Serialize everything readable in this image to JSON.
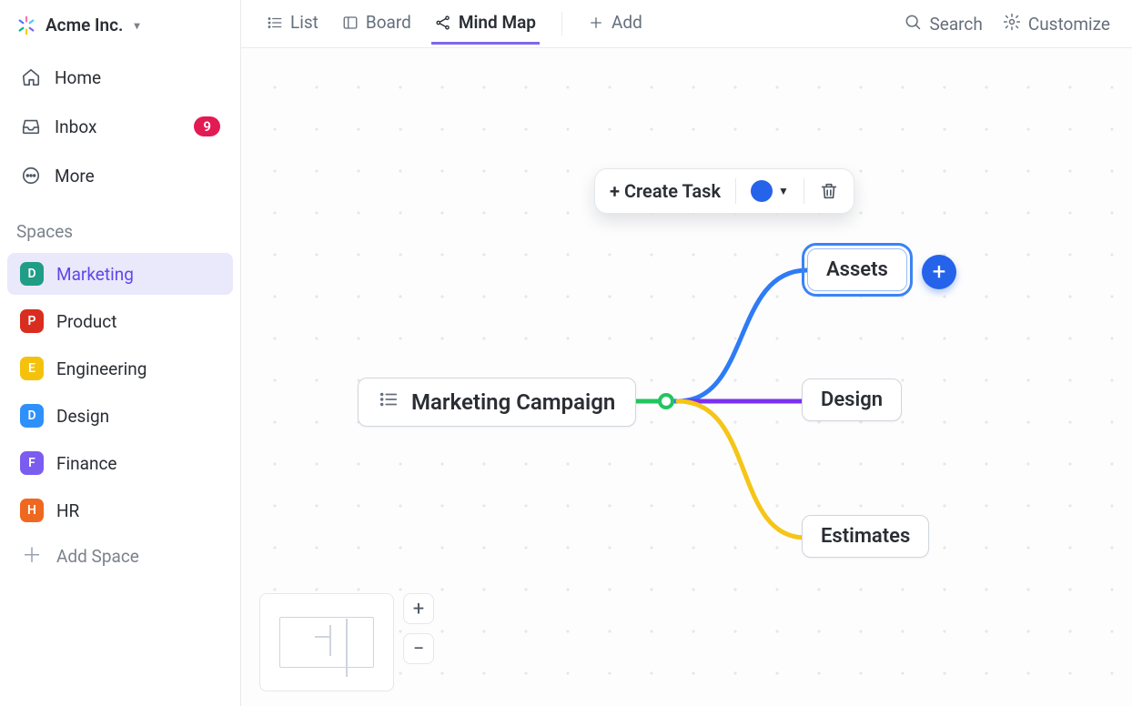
{
  "workspace": {
    "name": "Acme Inc."
  },
  "sidebar": {
    "nav": [
      {
        "label": "Home"
      },
      {
        "label": "Inbox",
        "badge": "9"
      },
      {
        "label": "More"
      }
    ],
    "section": "Spaces",
    "spaces": [
      {
        "letter": "D",
        "label": "Marketing",
        "color": "#1f9d86",
        "active": true
      },
      {
        "letter": "P",
        "label": "Product",
        "color": "#d92d20",
        "active": false
      },
      {
        "letter": "E",
        "label": "Engineering",
        "color": "#f4c20d",
        "active": false
      },
      {
        "letter": "D",
        "label": "Design",
        "color": "#2e90fa",
        "active": false
      },
      {
        "letter": "F",
        "label": "Finance",
        "color": "#7b5cf0",
        "active": false
      },
      {
        "letter": "H",
        "label": "HR",
        "color": "#ef6820",
        "active": false
      }
    ],
    "add_space": "Add Space"
  },
  "tabs": {
    "list": "List",
    "board": "Board",
    "mindmap": "Mind Map",
    "add": "Add",
    "search": "Search",
    "customize": "Customize"
  },
  "mindmap": {
    "root": "Marketing Campaign",
    "nodes": {
      "assets": "Assets",
      "design": "Design",
      "estimates": "Estimates"
    },
    "colors": {
      "assets": "#2e7bf6",
      "design": "#7b2ff2",
      "estimates": "#f5c518"
    }
  },
  "context": {
    "create": "+ Create Task",
    "color": "#2563eb"
  }
}
